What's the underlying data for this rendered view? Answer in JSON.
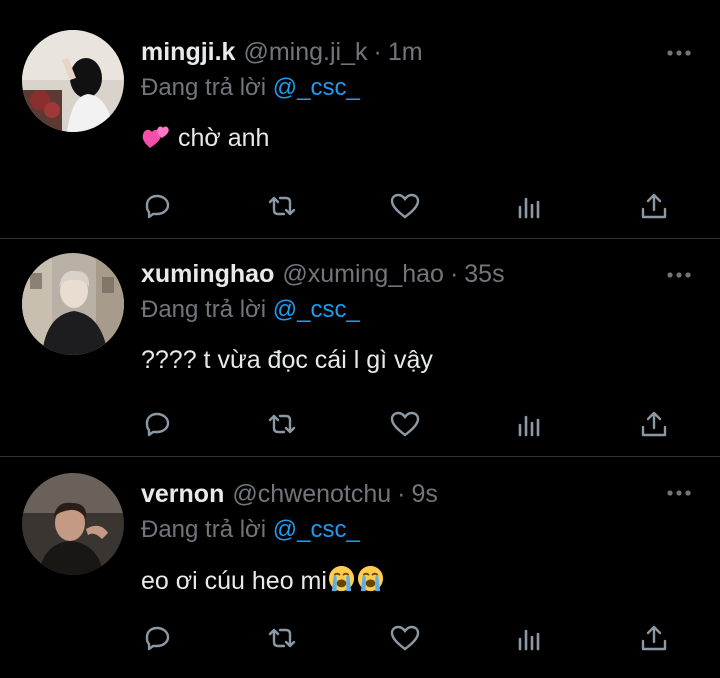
{
  "reply_prefix": "Đang trả lời",
  "tweets": [
    {
      "name": "mingji.k",
      "handle": "@ming.ji_k",
      "time": "1m",
      "mention": "@_csc_",
      "text": "chờ anh",
      "emoji_before": "two-hearts",
      "emoji_after": []
    },
    {
      "name": "xuminghao",
      "handle": "@xuming_hao",
      "time": "35s",
      "mention": "@_csc_",
      "text": "???? t vừa đọc cái l gì vậy",
      "emoji_before": "",
      "emoji_after": []
    },
    {
      "name": "vernon",
      "handle": "@chwenotchu",
      "time": "9s",
      "mention": "@_csc_",
      "text": "eo ơi cúu heo mi",
      "emoji_before": "",
      "emoji_after": [
        "loudly-crying-face",
        "loudly-crying-face"
      ]
    }
  ],
  "separator_dot": "·",
  "colors": {
    "background": "#000000",
    "text": "#e7e9ea",
    "muted": "#71767b",
    "link": "#1d9bf0"
  }
}
